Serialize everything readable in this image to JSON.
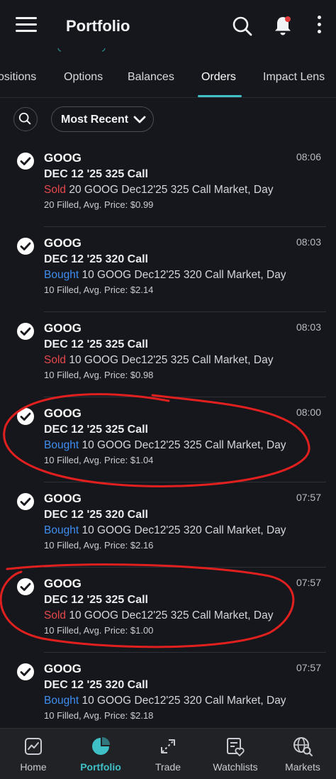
{
  "header": {
    "title": "Portfolio"
  },
  "tabs": [
    {
      "label": "ositions"
    },
    {
      "label": "Options"
    },
    {
      "label": "Balances"
    },
    {
      "label": "Orders",
      "active": true
    },
    {
      "label": "Impact Lens"
    }
  ],
  "filter": {
    "sort_label": "Most Recent"
  },
  "orders": [
    {
      "symbol": "GOOG",
      "time": "08:06",
      "contract": "DEC 12 '25 325 Call",
      "side": "Sold",
      "detail": " 20 GOOG Dec12'25 325 Call Market, Day",
      "fill": "20 Filled, Avg. Price: $0.99"
    },
    {
      "symbol": "GOOG",
      "time": "08:03",
      "contract": "DEC 12 '25 320 Call",
      "side": "Bought",
      "detail": " 10 GOOG Dec12'25 320 Call Market, Day",
      "fill": "10 Filled, Avg. Price: $2.14"
    },
    {
      "symbol": "GOOG",
      "time": "08:03",
      "contract": "DEC 12 '25 325 Call",
      "side": "Sold",
      "detail": " 10 GOOG Dec12'25 325 Call Market, Day",
      "fill": "10 Filled, Avg. Price: $0.98"
    },
    {
      "symbol": "GOOG",
      "time": "08:00",
      "contract": "DEC 12 '25 325 Call",
      "side": "Bought",
      "detail": " 10 GOOG Dec12'25 325 Call Market, Day",
      "fill": "10 Filled, Avg. Price: $1.04"
    },
    {
      "symbol": "GOOG",
      "time": "07:57",
      "contract": "DEC 12 '25 320 Call",
      "side": "Bought",
      "detail": " 10 GOOG Dec12'25 320 Call Market, Day",
      "fill": "10 Filled, Avg. Price: $2.16"
    },
    {
      "symbol": "GOOG",
      "time": "07:57",
      "contract": "DEC 12 '25 325 Call",
      "side": "Sold",
      "detail": " 10 GOOG Dec12'25 325 Call Market, Day",
      "fill": "10 Filled, Avg. Price: $1.00"
    },
    {
      "symbol": "GOOG",
      "time": "07:57",
      "contract": "DEC 12 '25 320 Call",
      "side": "Bought",
      "detail": " 10 GOOG Dec12'25 320 Call Market, Day",
      "fill": "10 Filled, Avg. Price: $2.18"
    }
  ],
  "bottom_nav": [
    {
      "label": "Home",
      "icon": "home-chart-icon"
    },
    {
      "label": "Portfolio",
      "icon": "pie-chart-icon",
      "active": true
    },
    {
      "label": "Trade",
      "icon": "trade-arrows-icon"
    },
    {
      "label": "Watchlists",
      "icon": "watchlist-heart-icon"
    },
    {
      "label": "Markets",
      "icon": "globe-search-icon"
    }
  ],
  "colors": {
    "accent": "#3fc0c6",
    "sell": "#e5484d",
    "buy": "#3d8ef0",
    "background": "#16171c",
    "annotation": "#e0201f"
  }
}
